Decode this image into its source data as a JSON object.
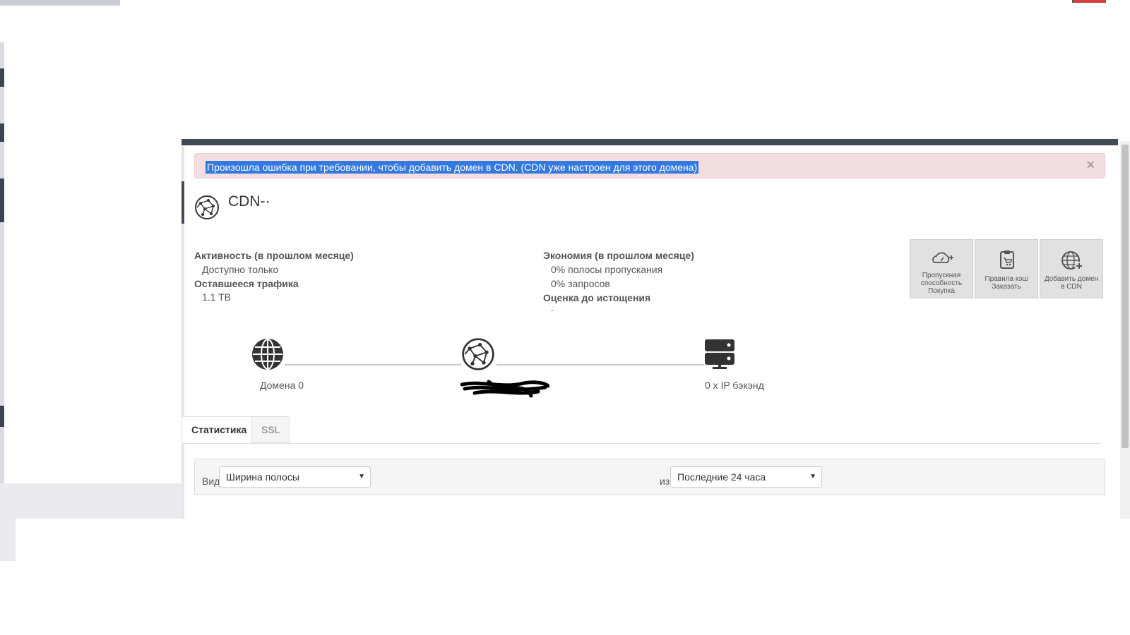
{
  "alert": {
    "message": "Произошла ошибка при требовании, чтобы добавить домен в CDN. (CDN уже настроен для этого домена)",
    "close_symbol": "×"
  },
  "header": {
    "title": "CDN-·",
    "icon": "network-globe-icon"
  },
  "stats": {
    "activity_label": "Активность (в прошлом месяце)",
    "activity_value": "Доступно только",
    "remaining_label": "Оставшееся трафика",
    "remaining_value": "1.1 TB",
    "savings_label": "Экономия (в прошлом месяце)",
    "savings_bandwidth": "0% полосы пропускания",
    "savings_requests": "0% запросов",
    "estimate_label": "Оценка до истощения",
    "estimate_value": "-"
  },
  "actions": [
    {
      "label": "Пропускная способность Покупка",
      "icon": "cloud-gauge-plus-icon"
    },
    {
      "label": "Правила кэш Заказать",
      "icon": "clipboard-cart-icon"
    },
    {
      "label": "Добавить домен в CDN",
      "icon": "globe-plus-icon"
    }
  ],
  "topology": {
    "domains_label": "Домена 0",
    "backend_label": "0 x IP бэкэнд"
  },
  "tabs": [
    {
      "label": "Статистика",
      "active": true
    },
    {
      "label": "SSL",
      "active": false
    }
  ],
  "filters": {
    "view_label": "Вид",
    "view_value": "Ширина полосы",
    "range_label": "из",
    "range_value": "Последние 24 часа",
    "caret": "▼"
  },
  "colors": {
    "topbar": "#414a57",
    "alert_bg": "#f2dede",
    "selection": "#3479e0"
  }
}
